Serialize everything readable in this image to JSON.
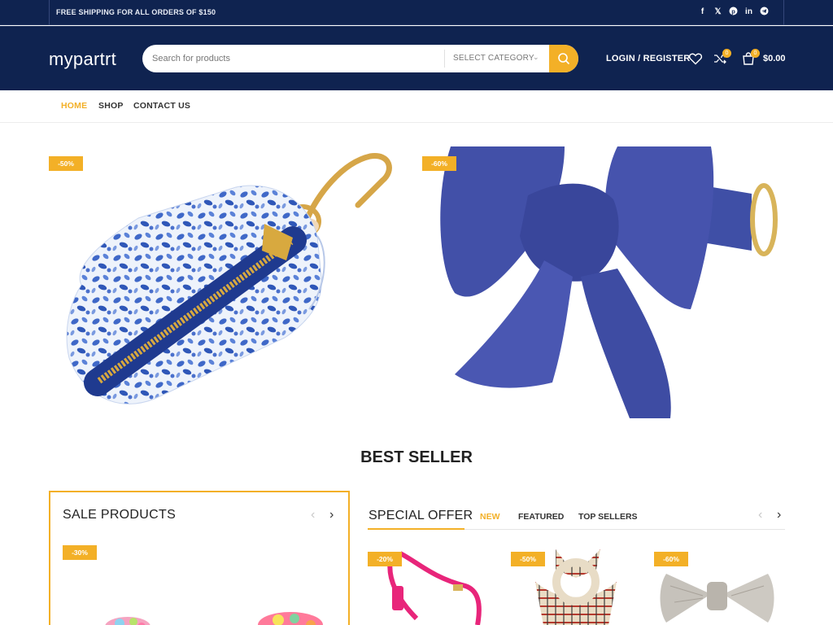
{
  "topbar": {
    "shipping_text": "FREE SHIPPING FOR ALL ORDERS OF $150",
    "social_icons": [
      "facebook-icon",
      "x-icon",
      "pinterest-icon",
      "linkedin-icon",
      "telegram-icon"
    ]
  },
  "header": {
    "logo": "mypartrt",
    "search_placeholder": "Search for products",
    "category_select": "SELECT CATEGORY",
    "login_label": "LOGIN / REGISTER",
    "compare_count": "0",
    "cart_count": "0",
    "cart_total": "$0.00"
  },
  "nav": {
    "items": [
      "HOME",
      "SHOP",
      "CONTACT US"
    ],
    "active": "HOME"
  },
  "hero": {
    "banners": [
      {
        "discount": "-50%",
        "image": "floral poop bag holder"
      },
      {
        "discount": "-60%",
        "image": "navy bow tie collar"
      }
    ]
  },
  "best_seller": {
    "title": "BEST SELLER"
  },
  "sale_products": {
    "title": "SALE PRODUCTS",
    "items": [
      {
        "discount": "-30%"
      }
    ]
  },
  "special_offer": {
    "title": "SPECIAL OFFER",
    "tabs": [
      "NEW",
      "FEATURED",
      "TOP SELLERS"
    ],
    "active_tab": "NEW",
    "products": [
      {
        "discount": "-20%"
      },
      {
        "discount": "-50%"
      },
      {
        "discount": "-60%"
      }
    ]
  },
  "colors": {
    "navy": "#0f2350",
    "accent": "#f3b027"
  }
}
